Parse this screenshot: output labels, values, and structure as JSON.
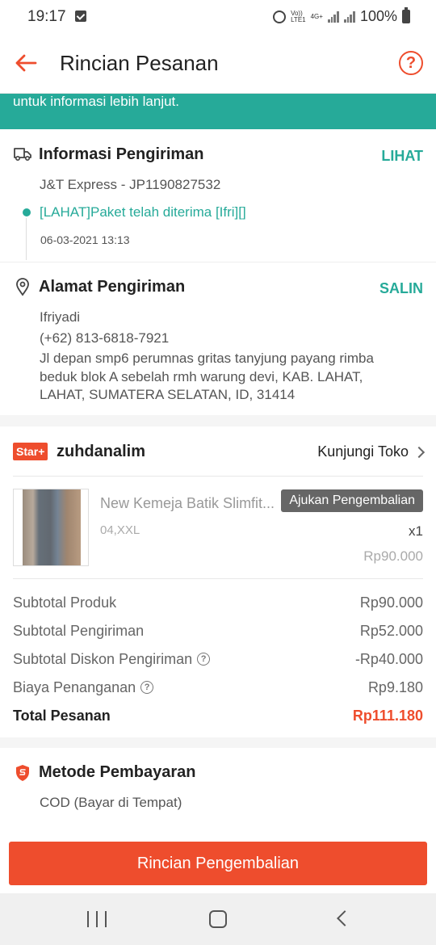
{
  "status_bar": {
    "time": "19:17",
    "network_top": "Vo))",
    "network_bottom": "LTE1",
    "network_gen": "4G+",
    "battery": "100%"
  },
  "header": {
    "title": "Rincian Pesanan",
    "help_label": "?"
  },
  "banner": {
    "text": "untuk informasi lebih lanjut."
  },
  "shipping": {
    "title": "Informasi Pengiriman",
    "action": "LIHAT",
    "courier": "J&T Express - JP1190827532",
    "latest_status": "[LAHAT]Paket telah diterima [Ifri][]",
    "timestamp": "06-03-2021 13:13"
  },
  "address": {
    "title": "Alamat Pengiriman",
    "action": "SALIN",
    "name": "Ifriyadi",
    "phone": "(+62) 813-6818-7921",
    "line1": "Jl depan smp6 perumnas gritas tanyjung payang rimba",
    "line2": "beduk blok A sebelah rmh warung devi, KAB. LAHAT,",
    "line3": "LAHAT, SUMATERA SELATAN, ID, 31414"
  },
  "shop": {
    "badge": "Star+",
    "name": "zuhdanalim",
    "visit_label": "Kunjungi Toko",
    "product": {
      "name": "New Kemeja Batik Slimfit...",
      "return_button": "Ajukan Pengembalian",
      "variant": "04,XXL",
      "quantity": "x1",
      "price": "Rp90.000"
    },
    "summary": [
      {
        "label": "Subtotal Produk",
        "value": "Rp90.000"
      },
      {
        "label": "Subtotal Pengiriman",
        "value": "Rp52.000"
      },
      {
        "label": "Subtotal Diskon Pengiriman",
        "value": "-Rp40.000"
      },
      {
        "label": "Biaya Penanganan",
        "value": "Rp9.180"
      }
    ],
    "total_label": "Total Pesanan",
    "total_value": "Rp111.180"
  },
  "payment": {
    "title": "Metode Pembayaran",
    "method": "COD (Bayar di Tempat)"
  },
  "bottom_button": {
    "label": "Rincian Pengembalian"
  },
  "colors": {
    "accent": "#ee4d2d",
    "green": "#26aa99"
  },
  "icons": {
    "back": "arrow-left-icon",
    "help": "question-circle-icon",
    "shipping": "truck-icon",
    "address": "location-pin-icon",
    "payment": "shield-payment-icon",
    "visit_shop": "chevron-right-icon",
    "nav_recent": "recent-apps-icon",
    "nav_home": "home-icon",
    "nav_back": "back-nav-icon"
  }
}
